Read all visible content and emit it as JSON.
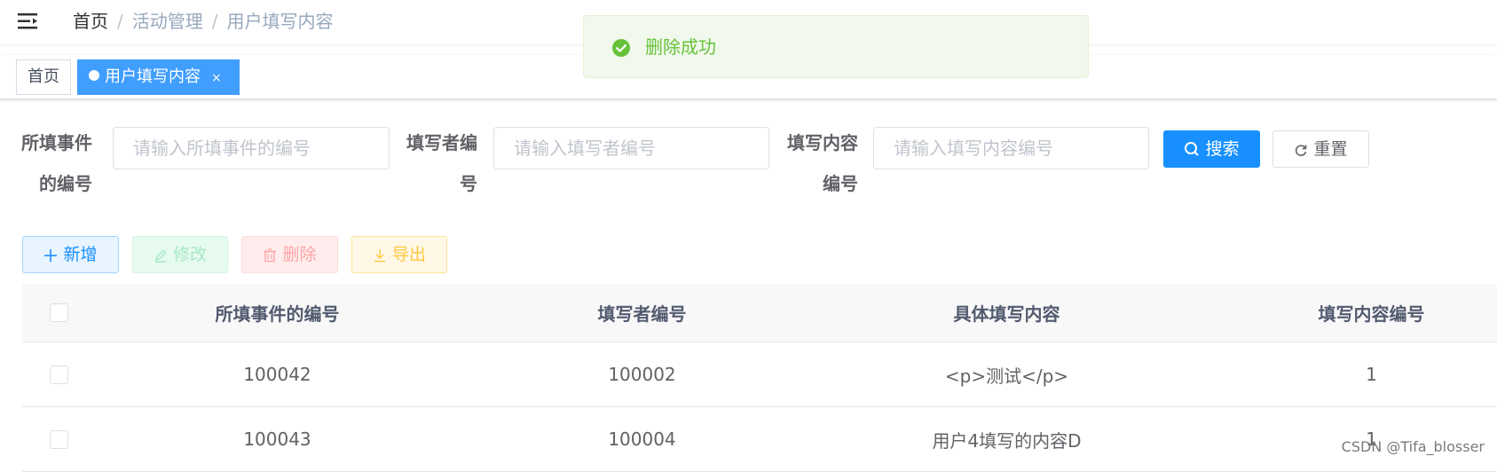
{
  "navbar": {
    "breadcrumb": [
      "首页",
      "活动管理",
      "用户填写内容"
    ],
    "separator": "/"
  },
  "tags": {
    "home": "首页",
    "active": "用户填写内容",
    "close": "×"
  },
  "message": {
    "text": "删除成功"
  },
  "search_form": {
    "field1": {
      "label_line1": "所填事件",
      "label_line2": "的编号",
      "placeholder": "请输入所填事件的编号"
    },
    "field2": {
      "label_line1": "填写者编",
      "label_line2": "号",
      "placeholder": "请输入填写者编号"
    },
    "field3": {
      "label_line1": "填写内容",
      "label_line2": "编号",
      "placeholder": "请输入填写内容编号"
    },
    "search_label": "搜索",
    "reset_label": "重置"
  },
  "toolbar": {
    "add_label": "新增",
    "edit_label": "修改",
    "delete_label": "删除",
    "export_label": "导出"
  },
  "table": {
    "columns": [
      "所填事件的编号",
      "填写者编号",
      "具体填写内容",
      "填写内容编号"
    ],
    "rows": [
      [
        "100042",
        "100002",
        "<p>测试</p>",
        "1"
      ],
      [
        "100043",
        "100004",
        "用户4填写的内容D",
        "1"
      ]
    ]
  },
  "watermark": "CSDN @Tifa_blosser",
  "colors": {
    "primary": "#1890ff",
    "success": "#67c23a",
    "danger": "#ffa4a4",
    "warning": "#ffc73f"
  }
}
